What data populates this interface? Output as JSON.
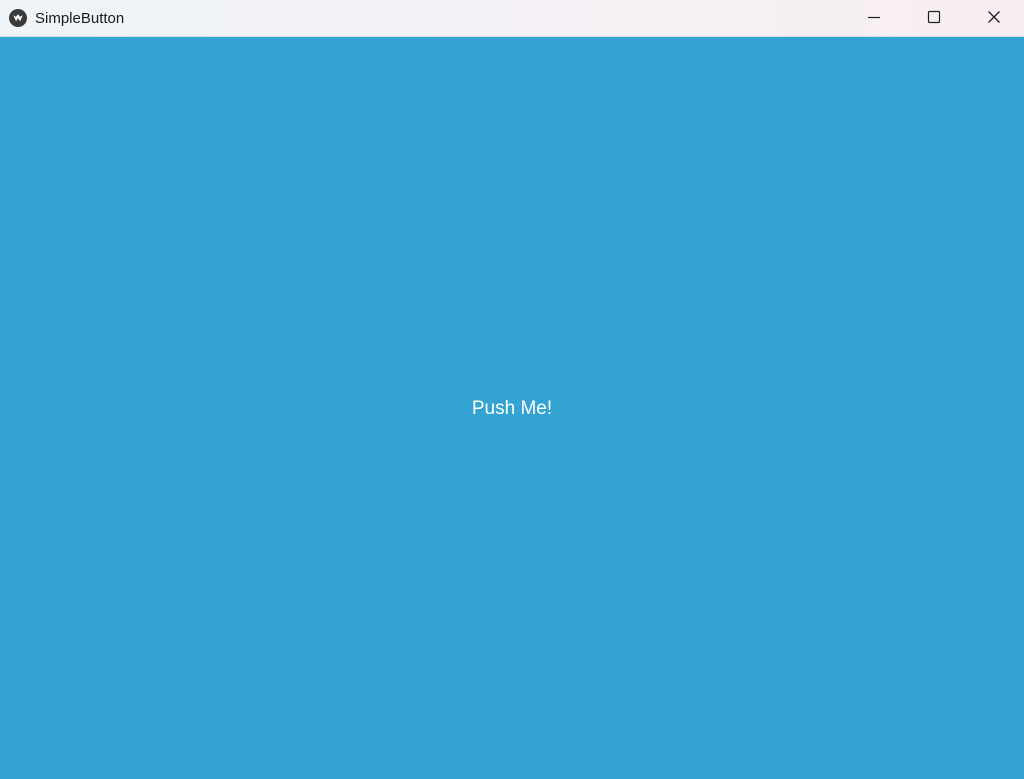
{
  "window": {
    "title": "SimpleButton",
    "controls": {
      "minimize_icon": "minimize-icon",
      "maximize_icon": "maximize-icon",
      "close_icon": "close-icon"
    },
    "colors": {
      "background": "#33a4d1",
      "title_text": "#1b1b1b",
      "button_text": "#ffffff"
    }
  },
  "main": {
    "button_label": "Push Me!"
  }
}
